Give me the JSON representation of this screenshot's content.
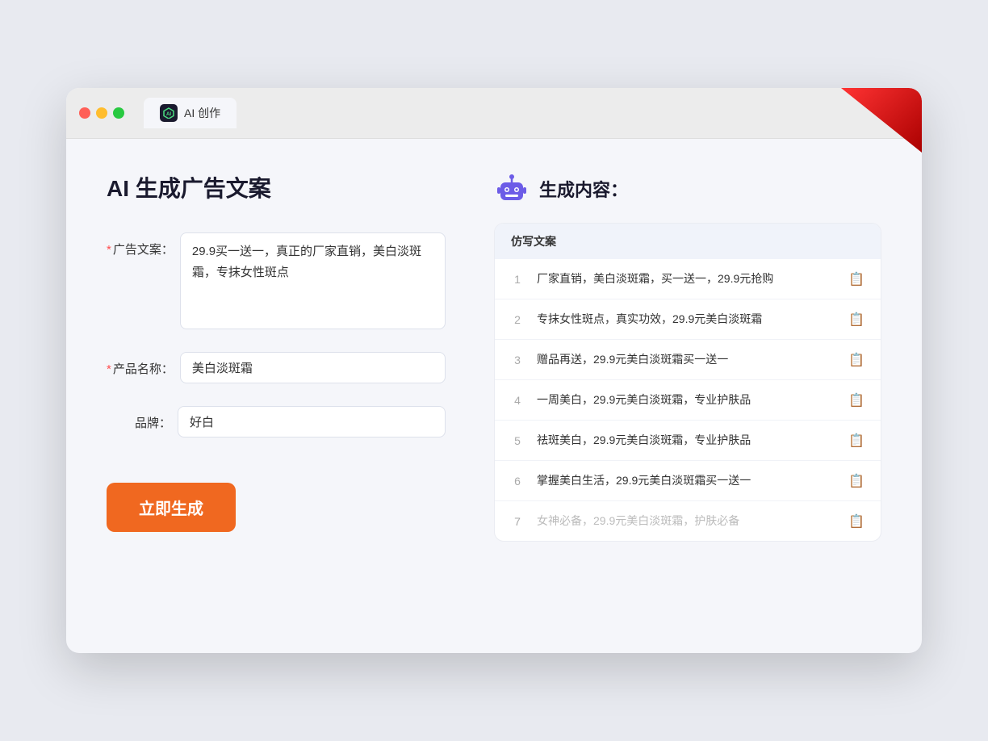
{
  "tab": {
    "label": "AI 创作"
  },
  "left": {
    "title": "AI 生成广告文案",
    "fields": [
      {
        "id": "ad-copy",
        "label": "广告文案：",
        "required": true,
        "type": "textarea",
        "value": "29.9买一送一，真正的厂家直销，美白淡斑霜，专抹女性斑点"
      },
      {
        "id": "product-name",
        "label": "产品名称：",
        "required": true,
        "type": "input",
        "value": "美白淡斑霜"
      },
      {
        "id": "brand",
        "label": "品牌：",
        "required": false,
        "type": "input",
        "value": "好白"
      }
    ],
    "generate_btn": "立即生成"
  },
  "right": {
    "title": "生成内容：",
    "table_header": "仿写文案",
    "results": [
      {
        "num": "1",
        "text": "厂家直销，美白淡斑霜，买一送一，29.9元抢购",
        "faded": false
      },
      {
        "num": "2",
        "text": "专抹女性斑点，真实功效，29.9元美白淡斑霜",
        "faded": false
      },
      {
        "num": "3",
        "text": "赠品再送，29.9元美白淡斑霜买一送一",
        "faded": false
      },
      {
        "num": "4",
        "text": "一周美白，29.9元美白淡斑霜，专业护肤品",
        "faded": false
      },
      {
        "num": "5",
        "text": "祛斑美白，29.9元美白淡斑霜，专业护肤品",
        "faded": false
      },
      {
        "num": "6",
        "text": "掌握美白生活，29.9元美白淡斑霜买一送一",
        "faded": false
      },
      {
        "num": "7",
        "text": "女神必备，29.9元美白淡斑霜，护肤必备",
        "faded": true
      }
    ]
  }
}
